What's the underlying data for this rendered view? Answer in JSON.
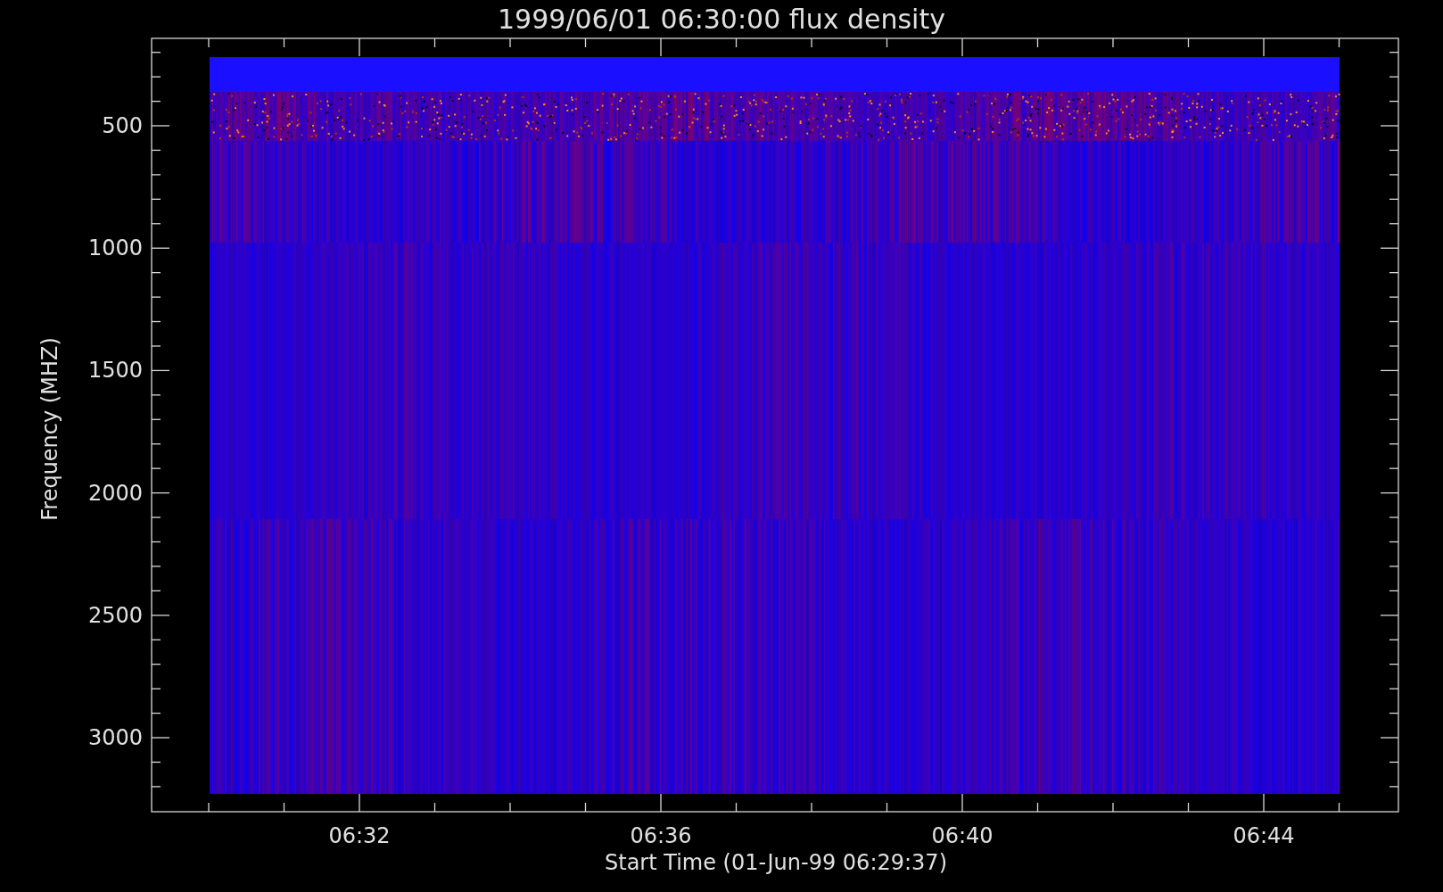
{
  "title": "1999/06/01 06:30:00 flux density",
  "y_axis": {
    "label": "Frequency (MHZ)",
    "tick_labels": [
      "500",
      "1000",
      "1500",
      "2000",
      "2500",
      "3000"
    ]
  },
  "x_axis": {
    "label": "Start Time (01-Jun-99 06:29:37)",
    "tick_labels": [
      "06:32",
      "06:36",
      "06:40",
      "06:44"
    ]
  }
}
